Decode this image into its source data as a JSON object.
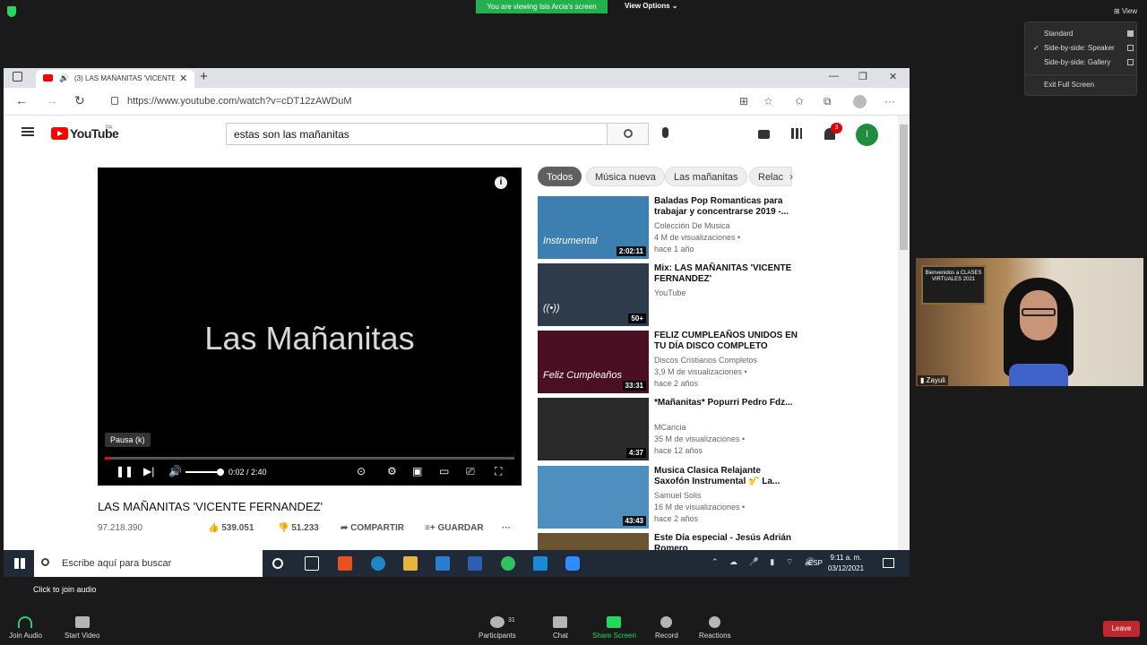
{
  "zoom": {
    "banner": "You are viewing Isis Arcia's screen",
    "view_options": "View Options ⌄",
    "view_button": "View",
    "view_menu": {
      "standard": "Standard",
      "side_speaker": "Side-by-side: Speaker",
      "side_gallery": "Side-by-side: Gallery",
      "exit_full": "Exit Full Screen",
      "check": "✓"
    },
    "join_tip": "Click to join audio",
    "bottom": {
      "join_audio": "Join Audio",
      "start_video": "Start Video",
      "participants": "Participants",
      "participants_count": "31",
      "chat": "Chat",
      "share_screen": "Share Screen",
      "record": "Record",
      "reactions": "Reactions",
      "leave": "Leave"
    },
    "webcam": {
      "name": "Zayuli",
      "sign": "Bienvenidos a CLASES VIRTUALES 2021"
    }
  },
  "browser": {
    "tab_title": "(3) LAS MAÑANITAS 'VICENTE FERNANDEZ'",
    "url": "https://www.youtube.com/watch?v=cDT12zAWDuM"
  },
  "youtube": {
    "logo_text": "YouTube",
    "logo_region": "PA",
    "search_value": "estas son las mañanitas",
    "notif_count": "3",
    "avatar_letter": "I",
    "player": {
      "title_overlay": "Las Mañanitas",
      "tooltip": "Pausa (k)",
      "time": "0:02 / 2:40",
      "progress_fraction": 0.013
    },
    "video": {
      "title": "LAS MAÑANITAS 'VICENTE FERNANDEZ'",
      "views": "97.218.390",
      "likes": "539.051",
      "dislikes": "51.233",
      "share": "COMPARTIR",
      "save": "GUARDAR",
      "more": "···"
    },
    "chips": [
      "Todos",
      "Música nueva",
      "Las mañanitas",
      "Relac"
    ],
    "recommendations": [
      {
        "title": "Baladas Pop Romanticas para trabajar y concentrarse 2019 -...",
        "channel": "Colección De Musica",
        "views": "4 M de visualizaciones •",
        "age": "hace 1 año",
        "duration": "2:02:11",
        "thumb_text": "Instrumental",
        "thumb_color": "#3c7fb0"
      },
      {
        "title": "Mix: LAS MAÑANITAS 'VICENTE FERNANDEZ'",
        "channel": "YouTube",
        "views": "",
        "age": "",
        "duration": "50+",
        "thumb_text": "((•))",
        "thumb_color": "#2d3b4a"
      },
      {
        "title": "FELIZ CUMPLEAÑOS UNIDOS EN TU DÍA DISCO COMPLETO",
        "channel": "Discos Cristianos Completos",
        "views": "3,9 M de visualizaciones •",
        "age": "hace 2 años",
        "duration": "33:31",
        "thumb_text": "Feliz Cumpleaños",
        "thumb_color": "#4a0f22"
      },
      {
        "title": "*Mañanitas* Popurri Pedro Fdz...",
        "channel": "MCaricia",
        "views": "35 M de visualizaciones •",
        "age": "hace 12 años",
        "duration": "4:37",
        "thumb_text": "",
        "thumb_color": "#2a2a2a"
      },
      {
        "title": "Musica Clasica Relajante Saxofón Instrumental 🎷 La...",
        "channel": "Samuel Solis",
        "views": "16 M de visualizaciones •",
        "age": "hace 2 años",
        "duration": "43:43",
        "thumb_text": "",
        "thumb_color": "#4f8fc0"
      },
      {
        "title": "Este Día especial - Jesús Adrián Romero",
        "channel": "",
        "views": "",
        "age": "",
        "duration": "",
        "thumb_text": "",
        "thumb_color": "#6a5432"
      }
    ]
  },
  "taskbar": {
    "search_placeholder": "Escribe aquí para buscar",
    "lang": "ESP",
    "time": "9:11 a. m.",
    "date": "03/12/2021"
  }
}
